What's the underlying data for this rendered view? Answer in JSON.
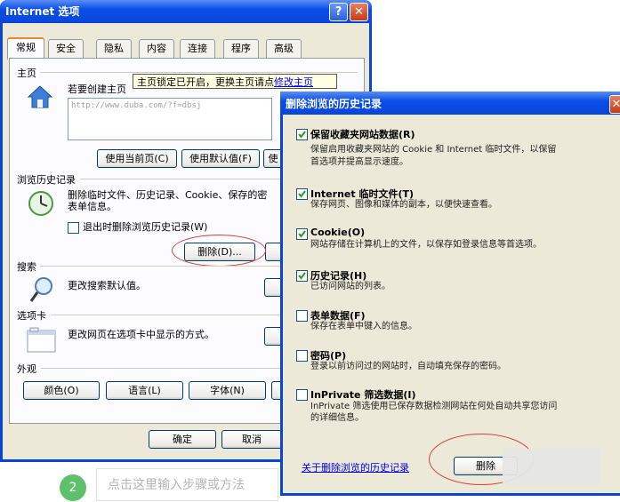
{
  "internet_options": {
    "title": "Internet 选项",
    "help_label": "?",
    "close_label": "✕",
    "tabs": [
      "常规",
      "安全",
      "隐私",
      "内容",
      "连接",
      "程序",
      "高级"
    ],
    "home": {
      "group_label": "主页",
      "desc": "若要创建主页",
      "url": "http://www.duba.com/?f=dbsj",
      "buttons": [
        "使用当前页(C)",
        "使用默认值(F)",
        "使"
      ]
    },
    "tooltip": {
      "text": "主页锁定已开启，更换主页请点",
      "link": "修改主页"
    },
    "history": {
      "group_label": "浏览历史记录",
      "desc_line1": "删除临时文件、历史记录、Cookie、保存的密",
      "desc_line2": "表单信息。",
      "checkbox_label": "退出时删除浏览历史记录(W)",
      "delete_button": "删除(D)..."
    },
    "search": {
      "group_label": "搜索",
      "desc": "更改搜索默认值。"
    },
    "tabs_section": {
      "group_label": "选项卡",
      "desc": "更改网页在选项卡中显示的方式。"
    },
    "appearance": {
      "group_label": "外观",
      "buttons": [
        "颜色(O)",
        "语言(L)",
        "字体(N)"
      ]
    },
    "footer_buttons": [
      "确定",
      "取消"
    ]
  },
  "delete_history": {
    "title": "删除浏览的历史记录",
    "items": [
      {
        "title": "保留收藏夹网站数据(R)",
        "checked": true,
        "desc1": "保留启用收藏夹网站的 Cookie 和 Internet 临时文件，以保留",
        "desc2": "首选项并提高显示速度。"
      },
      {
        "title": "Internet 临时文件(T)",
        "checked": true,
        "desc1": "保存网页、图像和媒体的副本，以便快速查看。",
        "desc2": ""
      },
      {
        "title": "Cookie(O)",
        "checked": true,
        "desc1": "网站存储在计算机上的文件，以保存如登录信息等首选项。",
        "desc2": ""
      },
      {
        "title": "历史记录(H)",
        "checked": true,
        "desc1": "已访问网站的列表。",
        "desc2": ""
      },
      {
        "title": "表单数据(F)",
        "checked": false,
        "desc1": "保存在表单中键入的信息。",
        "desc2": ""
      },
      {
        "title": "密码(P)",
        "checked": false,
        "desc1": "登录以前访问过的网站时，自动填充保存的密码。",
        "desc2": ""
      },
      {
        "title": "InPrivate 筛选数据(I)",
        "checked": false,
        "desc1": "InPrivate 筛选使用已保存数据检测网站在何处自动共享您访问",
        "desc2": "的详细信息。"
      }
    ],
    "about_link": "关于删除浏览的历史记录",
    "delete_button": "删除"
  },
  "step": {
    "number": "2",
    "placeholder": "点击这里输入步骤或方法"
  }
}
